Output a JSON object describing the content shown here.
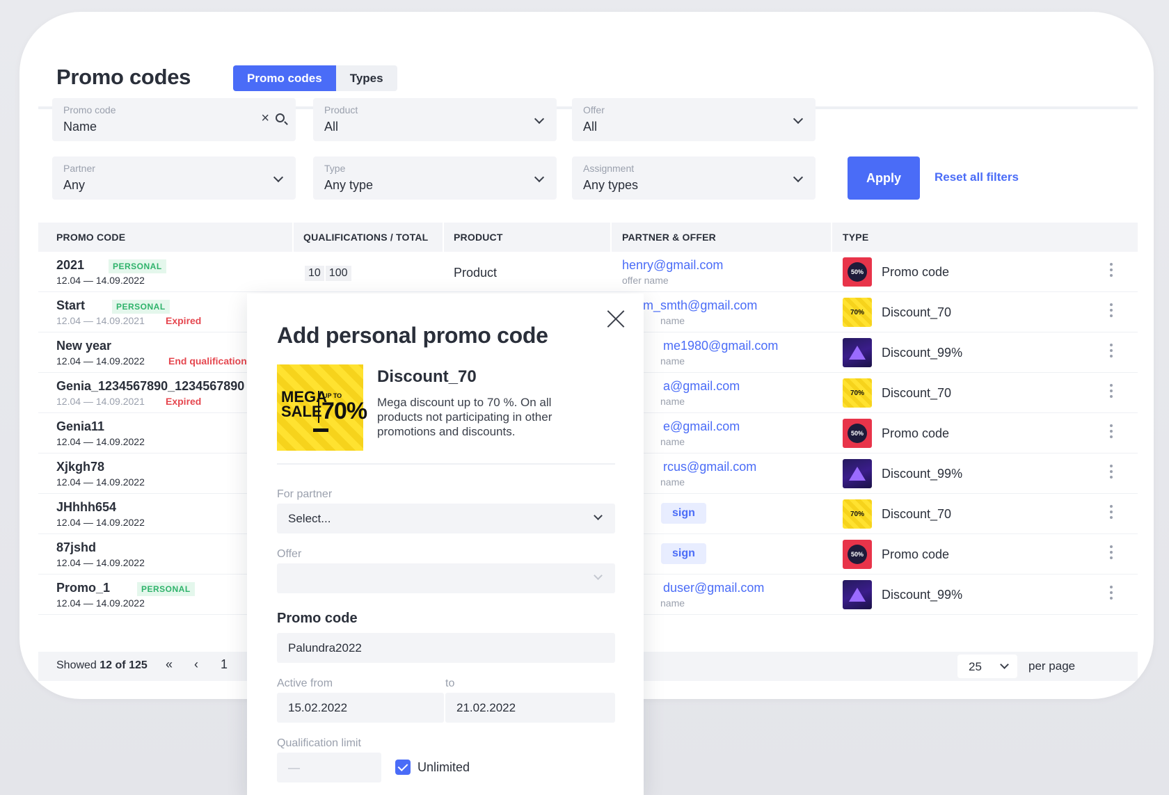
{
  "header": {
    "title": "Promo codes",
    "tabs": [
      {
        "label": "Promo codes",
        "active": true
      },
      {
        "label": "Types",
        "active": false
      }
    ]
  },
  "filters": {
    "promo_code": {
      "label": "Promo code",
      "value": "Name"
    },
    "product": {
      "label": "Product",
      "value": "All"
    },
    "offer": {
      "label": "Offer",
      "value": "All"
    },
    "partner": {
      "label": "Partner",
      "value": "Any"
    },
    "type": {
      "label": "Type",
      "value": "Any type"
    },
    "assignment": {
      "label": "Assignment",
      "value": "Any types"
    },
    "apply_label": "Apply",
    "reset_label": "Reset all filters"
  },
  "table": {
    "columns": [
      "PROMO CODE",
      "QUALIFICATIONS / TOTAL",
      "PRODUCT",
      "PARTNER & OFFER",
      "TYPE"
    ],
    "rows": [
      {
        "code": "2021",
        "badge": "PERSONAL",
        "dates": "12.04 — 14.09.2022",
        "status": "",
        "qualifications": "10",
        "total": "100",
        "product": "Product",
        "partner": "henry@gmail.com",
        "offer": "offer name",
        "type": "Promo code",
        "type_icon": "promo-image"
      },
      {
        "code": "Start",
        "badge": "PERSONAL",
        "dates": "12.04 — 14.09.2021",
        "status": "Expired",
        "partner": "adam_smth@gmail.com",
        "offer": "name",
        "type": "Discount_70",
        "type_icon": "mega-sale-image"
      },
      {
        "code": "New year",
        "badge": "",
        "dates": "12.04 — 14.09.2022",
        "status": "End qualifications",
        "partner": "me1980@gmail.com",
        "offer": "name",
        "type": "Discount_99%",
        "type_icon": "purple-triangle-image"
      },
      {
        "code": "Genia_1234567890_1234567890",
        "badge": "",
        "dates": "12.04 — 14.09.2021",
        "status": "Expired",
        "partner": "a@gmail.com",
        "offer": "name",
        "type": "Discount_70",
        "type_icon": "mega-sale-image"
      },
      {
        "code": "Genia11",
        "badge": "",
        "dates": "12.04 — 14.09.2022",
        "status": "",
        "partner": "e@gmail.com",
        "offer": "name",
        "type": "Promo code",
        "type_icon": "promo-image"
      },
      {
        "code": "Xjkgh78",
        "badge": "",
        "dates": "12.04 — 14.09.2022",
        "status": "",
        "partner": "rcus@gmail.com",
        "offer": "name",
        "type": "Discount_99%",
        "type_icon": "purple-triangle-image"
      },
      {
        "code": "JHhhh654",
        "badge": "",
        "dates": "12.04 — 14.09.2022",
        "status": "",
        "assign": "sign",
        "type": "Discount_70",
        "type_icon": "mega-sale-image"
      },
      {
        "code": "87jshd",
        "badge": "",
        "dates": "12.04 — 14.09.2022",
        "status": "",
        "assign": "sign",
        "type": "Promo code",
        "type_icon": "promo-image"
      },
      {
        "code": "Promo_1",
        "badge": "PERSONAL",
        "dates": "12.04 — 14.09.2022",
        "status": "",
        "partner": "duser@gmail.com",
        "offer": "name",
        "type": "Discount_99%",
        "type_icon": "purple-triangle-image"
      }
    ]
  },
  "footer": {
    "showed_prefix": "Showed",
    "showed_count": "12 of 125",
    "page": "1",
    "first_icon": "«",
    "prev_icon": "‹",
    "per_page_value": "25",
    "per_page_label": "per page"
  },
  "modal": {
    "title": "Add personal promo code",
    "offer_title": "Discount_70",
    "offer_description": "Mega discount up to 70 %. On all products not participating in other promotions and discounts.",
    "offer_image": {
      "line1": "MEGA",
      "line2": "SALE",
      "upto": "UP TO",
      "percent": "70%"
    },
    "partner_label": "For partner",
    "partner_value": "Select...",
    "offer_label": "Offer",
    "offer_value": "",
    "promo_section": "Promo code",
    "promo_value": "Palundra2022",
    "active_from_label": "Active from",
    "to_label": "to",
    "from_value": "15.02.2022",
    "to_value": "21.02.2022",
    "limit_label": "Qualification limit",
    "limit_placeholder": "—",
    "unlimited_label": "Unlimited",
    "unlimited_checked": true
  },
  "colors": {
    "accent": "#4a6cf7",
    "badge_green": "#2fb36b",
    "danger": "#e5474f"
  }
}
